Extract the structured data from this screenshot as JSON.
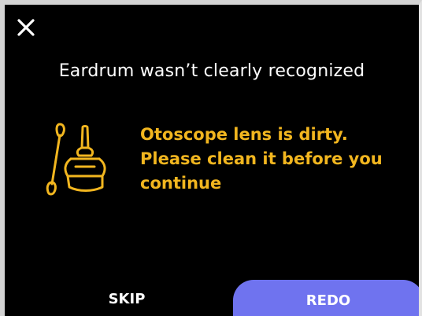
{
  "header": {
    "close_icon": "close-icon"
  },
  "title": "Eardrum wasn’t clearly recognized",
  "message": {
    "lines": [
      "Otoscope lens is dirty.",
      "Please clean it before you",
      "continue"
    ],
    "color": "#f2b61f"
  },
  "illustration": {
    "icon": "otoscope-cleaning-icon"
  },
  "actions": {
    "skip_label": "SKIP",
    "redo_label": "REDO",
    "redo_color": "#6f73ef"
  }
}
